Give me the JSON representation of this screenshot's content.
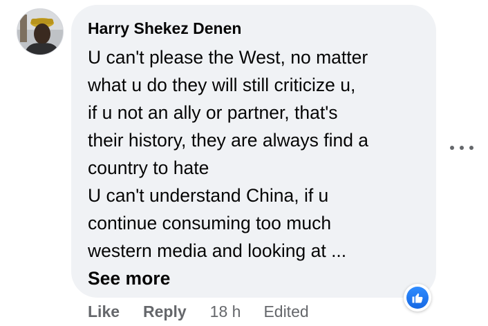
{
  "comment": {
    "author": "Harry Shekez Denen",
    "lines": [
      "U can't please the West, no matter",
      "what u do they will still criticize u,",
      "if u not an ally or partner, that's",
      "their history, they are always find a",
      "country to hate",
      "U can't understand China, if u",
      "continue consuming too much",
      "western media and looking at ..."
    ],
    "see_more_label": "See more",
    "reaction_icon": "thumbs-up-icon",
    "options_icon": "more-options-icon"
  },
  "actions": {
    "like_label": "Like",
    "reply_label": "Reply",
    "timestamp": "18 h",
    "edited_label": "Edited"
  },
  "colors": {
    "bubble_bg": "#f0f2f5",
    "text_primary": "#050505",
    "text_secondary": "#65676b",
    "reaction_blue": "#1877f2"
  }
}
